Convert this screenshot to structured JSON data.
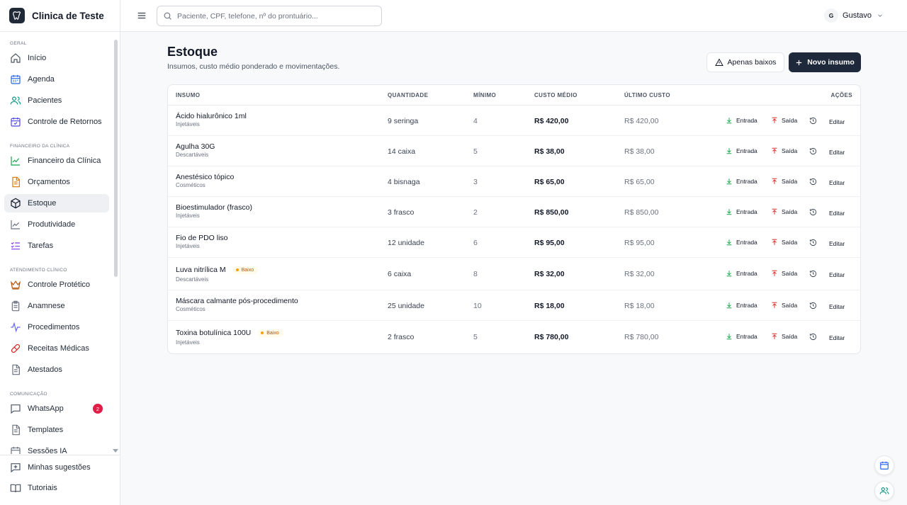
{
  "app": {
    "name": "Clinica de Teste"
  },
  "header": {
    "search_placeholder": "Paciente, CPF, telefone, nº do prontuário...",
    "user_initial": "G",
    "user_name": "Gustavo"
  },
  "sidebar": {
    "sections": {
      "geral": "GERAL",
      "financeiro": "FINANCEIRO DA CLÍNICA",
      "atendimento": "ATENDIMENTO CLÍNICO",
      "comunicacao": "COMUNICAÇÃO"
    },
    "items": {
      "inicio": "Início",
      "agenda": "Agenda",
      "pacientes": "Pacientes",
      "retornos": "Controle de Retornos",
      "financeiro": "Financeiro da Clínica",
      "orcamentos": "Orçamentos",
      "estoque": "Estoque",
      "produtividade": "Produtividade",
      "tarefas": "Tarefas",
      "protetico": "Controle Protético",
      "anamnese": "Anamnese",
      "procedimentos": "Procedimentos",
      "receitas": "Receitas Médicas",
      "atestados": "Atestados",
      "whatsapp": "WhatsApp",
      "templates": "Templates",
      "sessoes": "Sessões IA"
    },
    "whatsapp_badge": "2",
    "bottom": {
      "sugestoes": "Minhas sugestões",
      "tutoriais": "Tutoriais"
    }
  },
  "main": {
    "title": "Estoque",
    "subtitle": "Insumos, custo médio ponderado e movimentações.",
    "btn_low": "Apenas baixos",
    "btn_new": "Novo insumo",
    "columns": {
      "insumo": "INSUMO",
      "quantidade": "QUANTIDADE",
      "minimo": "MÍNIMO",
      "custo_medio": "CUSTO MÉDIO",
      "ultimo_custo": "ÚLTIMO CUSTO",
      "acoes": "AÇÕES"
    },
    "actions": {
      "entrada": "Entrada",
      "saida": "Saída",
      "editar": "Editar"
    },
    "low_label": "Baixo",
    "rows": [
      {
        "name": "Ácido hialurônico 1ml",
        "category": "Injetáveis",
        "qty": "9 seringa",
        "min": "4",
        "avg": "R$ 420,00",
        "last": "R$ 420,00",
        "low": false
      },
      {
        "name": "Agulha 30G",
        "category": "Descartáveis",
        "qty": "14 caixa",
        "min": "5",
        "avg": "R$ 38,00",
        "last": "R$ 38,00",
        "low": false
      },
      {
        "name": "Anestésico tópico",
        "category": "Cosméticos",
        "qty": "4 bisnaga",
        "min": "3",
        "avg": "R$ 65,00",
        "last": "R$ 65,00",
        "low": false
      },
      {
        "name": "Bioestimulador (frasco)",
        "category": "Injetáveis",
        "qty": "3 frasco",
        "min": "2",
        "avg": "R$ 850,00",
        "last": "R$ 850,00",
        "low": false
      },
      {
        "name": "Fio de PDO liso",
        "category": "Injetáveis",
        "qty": "12 unidade",
        "min": "6",
        "avg": "R$ 95,00",
        "last": "R$ 95,00",
        "low": false
      },
      {
        "name": "Luva nitrílica M",
        "category": "Descartáveis",
        "qty": "6 caixa",
        "min": "8",
        "avg": "R$ 32,00",
        "last": "R$ 32,00",
        "low": true
      },
      {
        "name": "Máscara calmante pós-procedimento",
        "category": "Cosméticos",
        "qty": "25 unidade",
        "min": "10",
        "avg": "R$ 18,00",
        "last": "R$ 18,00",
        "low": false
      },
      {
        "name": "Toxina botulínica 100U",
        "category": "Injetáveis",
        "qty": "2 frasco",
        "min": "5",
        "avg": "R$ 780,00",
        "last": "R$ 780,00",
        "low": true
      }
    ]
  },
  "colors": {
    "accent_dark": "#1e293b",
    "entrada_green": "#16a34a",
    "saida_red": "#dc2626",
    "low_amber": "#f59e0b",
    "badge_red": "#e11d48"
  }
}
